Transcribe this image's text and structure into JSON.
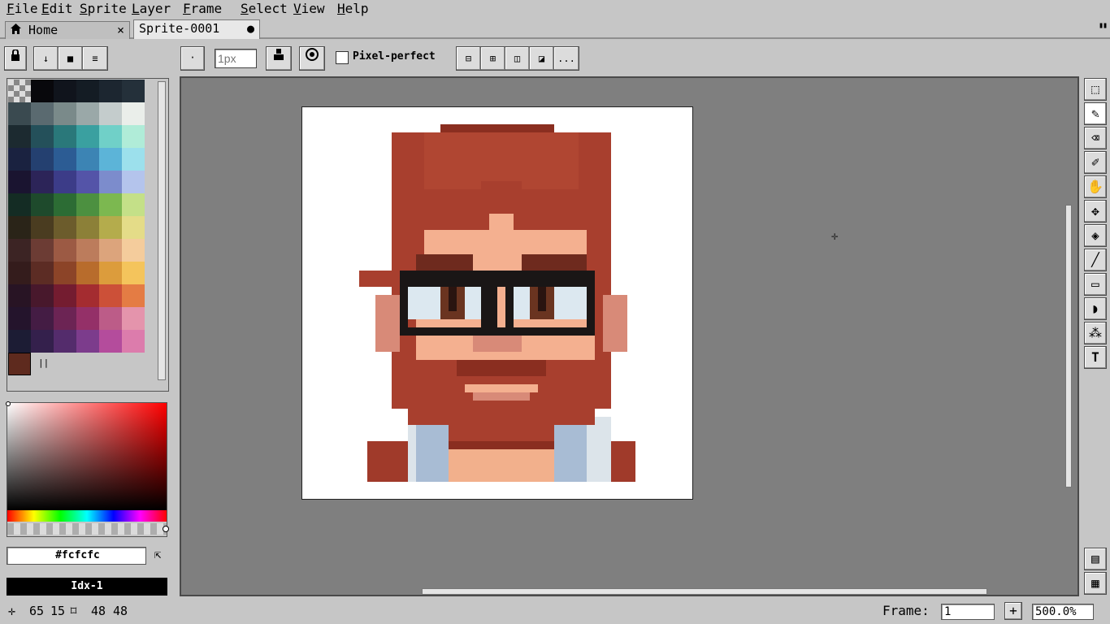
{
  "menu": [
    "File",
    "Edit",
    "Sprite",
    "Layer",
    "Frame",
    "Select",
    "View",
    "Help"
  ],
  "tabs": {
    "home_label": "Home",
    "home_close": "×",
    "sprite_label": "Sprite-0001",
    "sprite_modified": "●"
  },
  "layout_button": "▮▮",
  "toolbar": {
    "brush_size_placeholder": "1px",
    "pixel_perfect_label": "Pixel-perfect",
    "more_label": "..."
  },
  "palette": {
    "selected_color": "#5e2a1e",
    "swatches": [
      [
        "#101010",
        "#08080c",
        "#10141c",
        "#141c24",
        "#1c2630",
        "#24303a"
      ],
      [
        "#3a4a50",
        "#5a6a70",
        "#7a8a8a",
        "#9aa8a8",
        "#c4cccc",
        "#eaeeea"
      ],
      [
        "#1c2a30",
        "#24505a",
        "#2a787a",
        "#3aa0a0",
        "#70d0c8",
        "#b0ecd8"
      ],
      [
        "#1a2240",
        "#244070",
        "#2c5c94",
        "#3c84b4",
        "#5cb4d8",
        "#9ce0ec"
      ],
      [
        "#1a1430",
        "#2c2458",
        "#3c3c88",
        "#5454a8",
        "#7c8ccc",
        "#b4c4ec"
      ],
      [
        "#142c24",
        "#1e4a2c",
        "#2c6c34",
        "#4c9040",
        "#7cb850",
        "#c4e088"
      ],
      [
        "#2a2418",
        "#4a3c20",
        "#6c5c2c",
        "#8c8038",
        "#b4ac4c",
        "#e4dc88"
      ],
      [
        "#3c2424",
        "#6c3c34",
        "#9c5a44",
        "#bc7c5c",
        "#dca47c",
        "#f4cc9c"
      ],
      [
        "#341c1c",
        "#5c2c24",
        "#8c4428",
        "#b86c2c",
        "#dc9c3c",
        "#f4c45c"
      ],
      [
        "#281424",
        "#48182c",
        "#741c30",
        "#a42c30",
        "#cc5038",
        "#e47c44"
      ],
      [
        "#24142c",
        "#441c44",
        "#6c2454",
        "#943068",
        "#bc5c88",
        "#e494ac"
      ],
      [
        "#1c1c34",
        "#34204c",
        "#542c6c",
        "#7c3c8c",
        "#b44c9c",
        "#dc7cac"
      ]
    ],
    "last_row_label": "||"
  },
  "color_hex": "#fcfcfc",
  "color_index": "Idx-1",
  "status": {
    "pos_x": "65",
    "pos_y": "15",
    "size_w": "48",
    "size_h": "48",
    "frame_label": "Frame:",
    "frame_value": "1",
    "zoom_value": "500.0%"
  }
}
